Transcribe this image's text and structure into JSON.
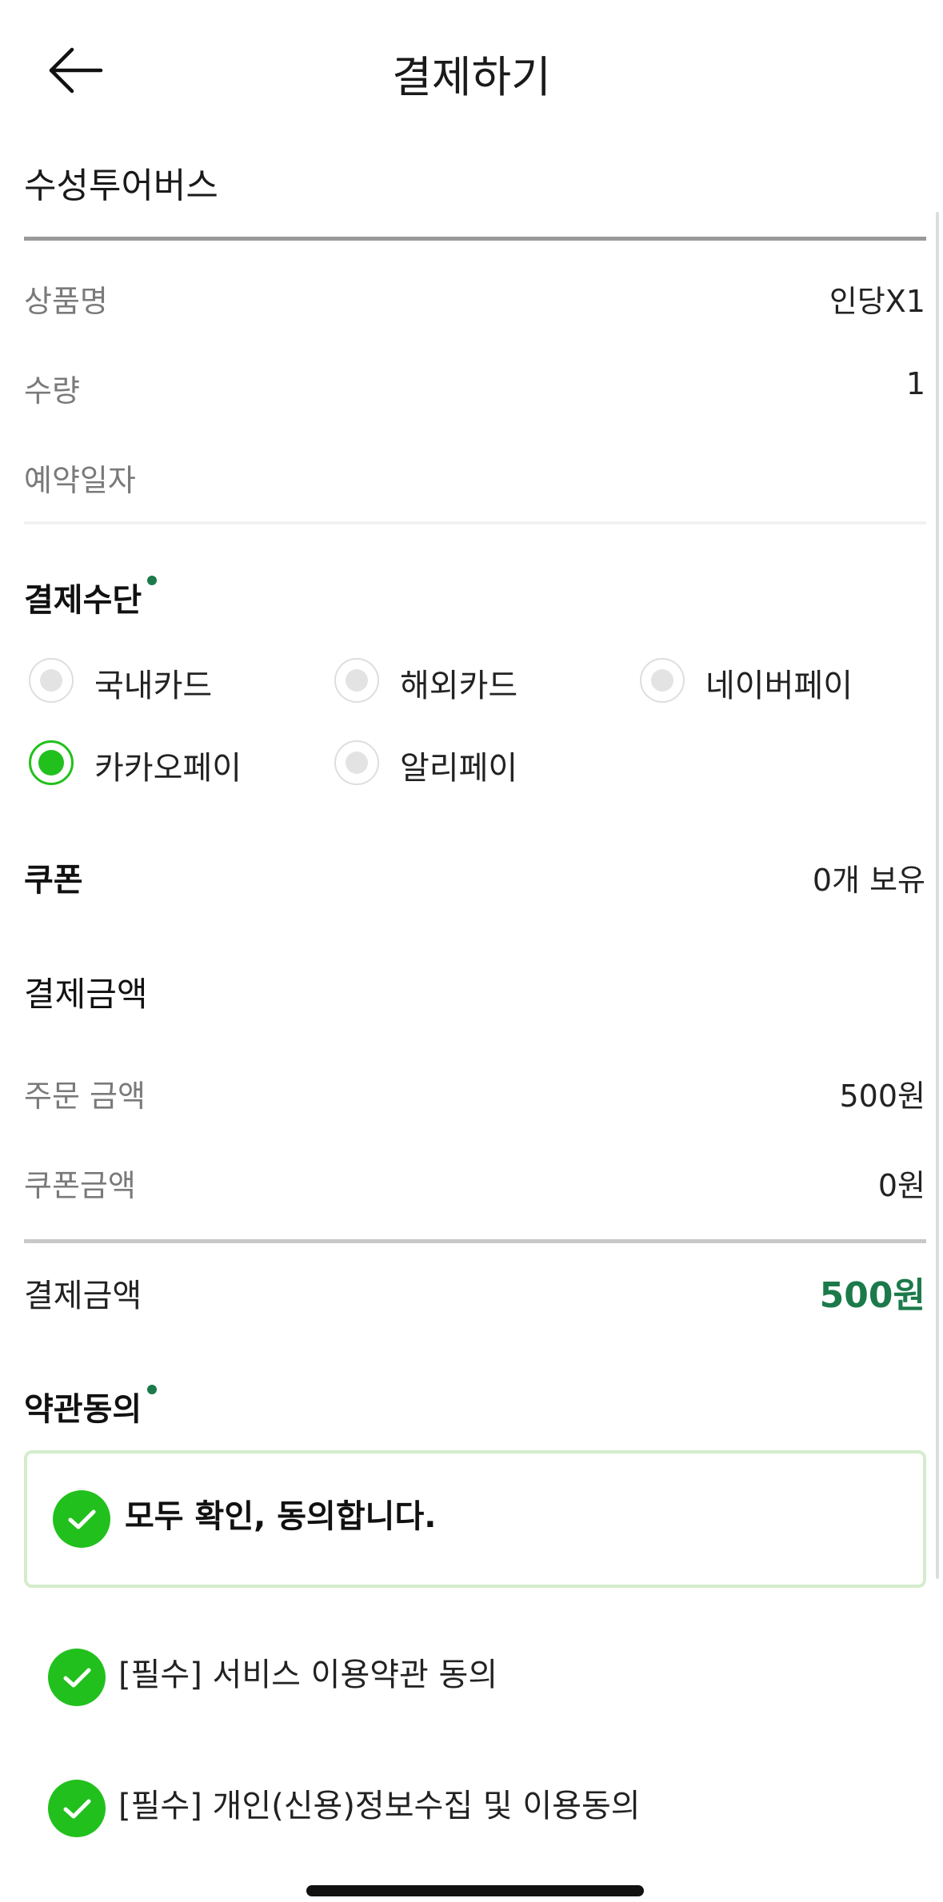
{
  "header": {
    "title": "결제하기",
    "back_icon": "arrow-left-icon"
  },
  "shop": {
    "name": "수성투어버스"
  },
  "product": {
    "rows": [
      {
        "label": "상품명",
        "value": "인당X1"
      },
      {
        "label": "수량",
        "value": "1"
      },
      {
        "label": "예약일자",
        "value": ""
      }
    ]
  },
  "payment_method": {
    "title": "결제수단",
    "options": [
      {
        "label": "국내카드",
        "selected": false
      },
      {
        "label": "해외카드",
        "selected": false
      },
      {
        "label": "네이버페이",
        "selected": false
      },
      {
        "label": "카카오페이",
        "selected": true
      },
      {
        "label": "알리페이",
        "selected": false
      }
    ]
  },
  "coupon": {
    "title": "쿠폰",
    "value": "0개 보유"
  },
  "amount": {
    "title": "결제금액",
    "order_label": "주문 금액",
    "order_value": "500원",
    "coupon_label": "쿠폰금액",
    "coupon_value": "0원",
    "total_label": "결제금액",
    "total_value": "500원"
  },
  "terms": {
    "title": "약관동의",
    "all_label": "모두 확인, 동의합니다.",
    "items": [
      {
        "label": "[필수] 서비스 이용약관 동의"
      },
      {
        "label": "[필수] 개인(신용)정보수집 및 이용동의"
      }
    ]
  },
  "colors": {
    "accent_green": "#22c01d",
    "price_green": "#1c7a4a",
    "agree_border": "#d4eccc"
  }
}
